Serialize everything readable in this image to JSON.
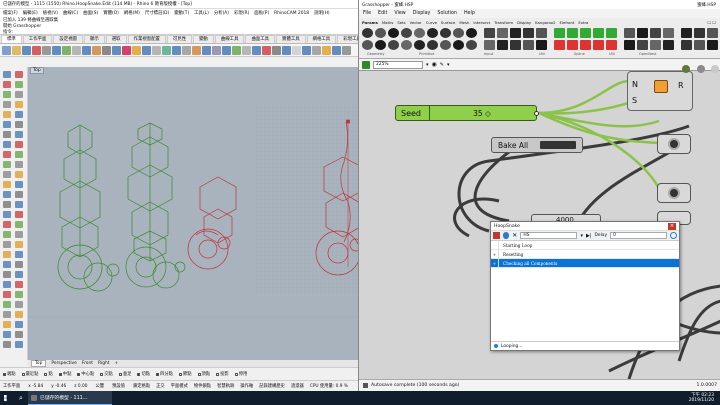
{
  "rhino": {
    "title": "已儲存的模型 - 1115 (1550) Rhino.HoopSnake.Edit (114 MB) - Rhino 6 教育版授權 - [Top]",
    "menu": [
      "檔案(F)",
      "編輯(E)",
      "檢視(V)",
      "曲線(C)",
      "曲面(S)",
      "實體(O)",
      "網格(M)",
      "尺寸標註(D)",
      "變動(T)",
      "工具(L)",
      "分析(A)",
      "彩現(R)",
      "面板(P)",
      "RhinoCAM 2018",
      "說明(H)"
    ],
    "command_history": [
      "已加入 139 條曲線至選取集",
      "開始 Grasshopper",
      "指令:"
    ],
    "tabs": [
      "標準",
      "工作平面",
      "設定視圖",
      "顯示",
      "選取",
      "作業視窗配置",
      "可見性",
      "變動",
      "曲線工具",
      "曲面工具",
      "實體工具",
      "網格工具",
      "彩現工具",
      "出圖",
      "V6 的新功能"
    ],
    "viewport_name": "Top",
    "viewport_tabs": [
      "Top",
      "Perspective",
      "Front",
      "Right",
      "+"
    ],
    "osnaps": [
      {
        "label": "端點",
        "on": true
      },
      {
        "label": "最近點",
        "on": false
      },
      {
        "label": "點",
        "on": false
      },
      {
        "label": "中點",
        "on": true
      },
      {
        "label": "中心點",
        "on": true
      },
      {
        "label": "交點",
        "on": false
      },
      {
        "label": "垂足",
        "on": false
      },
      {
        "label": "切點",
        "on": true
      },
      {
        "label": "四分點",
        "on": true
      },
      {
        "label": "節點",
        "on": false
      },
      {
        "label": "頂點",
        "on": false
      },
      {
        "label": "投影",
        "on": false
      },
      {
        "label": "停用",
        "on": false
      }
    ],
    "status": {
      "cplane": "工作平面",
      "x": "x -5.84",
      "y": "y -0.46",
      "z": "z 0.00",
      "units": "公釐",
      "layer": "預設值",
      "items": [
        "鎖定格點",
        "正交",
        "平面模式",
        "物件鎖點",
        "智慧軌跡",
        "操作軸",
        "記錄建構歷史",
        "過濾器",
        "CPU 使用量: 0.9 %"
      ]
    }
  },
  "gh": {
    "title": "Grasshopper - 蜜蜂.HSP",
    "title_right": "蜜蜂.HSP",
    "menu": [
      "File",
      "Edit",
      "View",
      "Display",
      "Solution",
      "Help"
    ],
    "categories": [
      "Params",
      "Maths",
      "Sets",
      "Vector",
      "Curve",
      "Surface",
      "Mesh",
      "Intersect",
      "Transform",
      "Display",
      "Kangaroo2",
      "Elefront",
      "Extra"
    ],
    "ribbon_groups": [
      "Geometry",
      "Primitive",
      "Input",
      "Util",
      "Spline",
      "Util",
      "OpenNest"
    ],
    "zoom": "225%",
    "seed_label": "Seed",
    "seed_value": "35 ◇",
    "bake_label": "Bake All",
    "ns_inputs": [
      "N",
      "S"
    ],
    "ns_output": "R",
    "hidden_num": "4000",
    "status_text": "Autosave complete (100 seconds ago)",
    "version": "1.0.0007",
    "hoopsnake": {
      "title": "HoopSnake",
      "loop_field": "HS",
      "delay_label": "Delay",
      "delay_value": "0",
      "log": [
        {
          "text": "Starting Loop",
          "selected": false
        },
        {
          "text": "Resetting",
          "selected": false
        },
        {
          "text": "Checking all Components",
          "selected": true
        }
      ],
      "footer": "Looping..."
    }
  },
  "taskbar": {
    "app_label": "已儲存的模型 - 111...",
    "time": "下午 02:23",
    "date": "2019/11/20"
  }
}
